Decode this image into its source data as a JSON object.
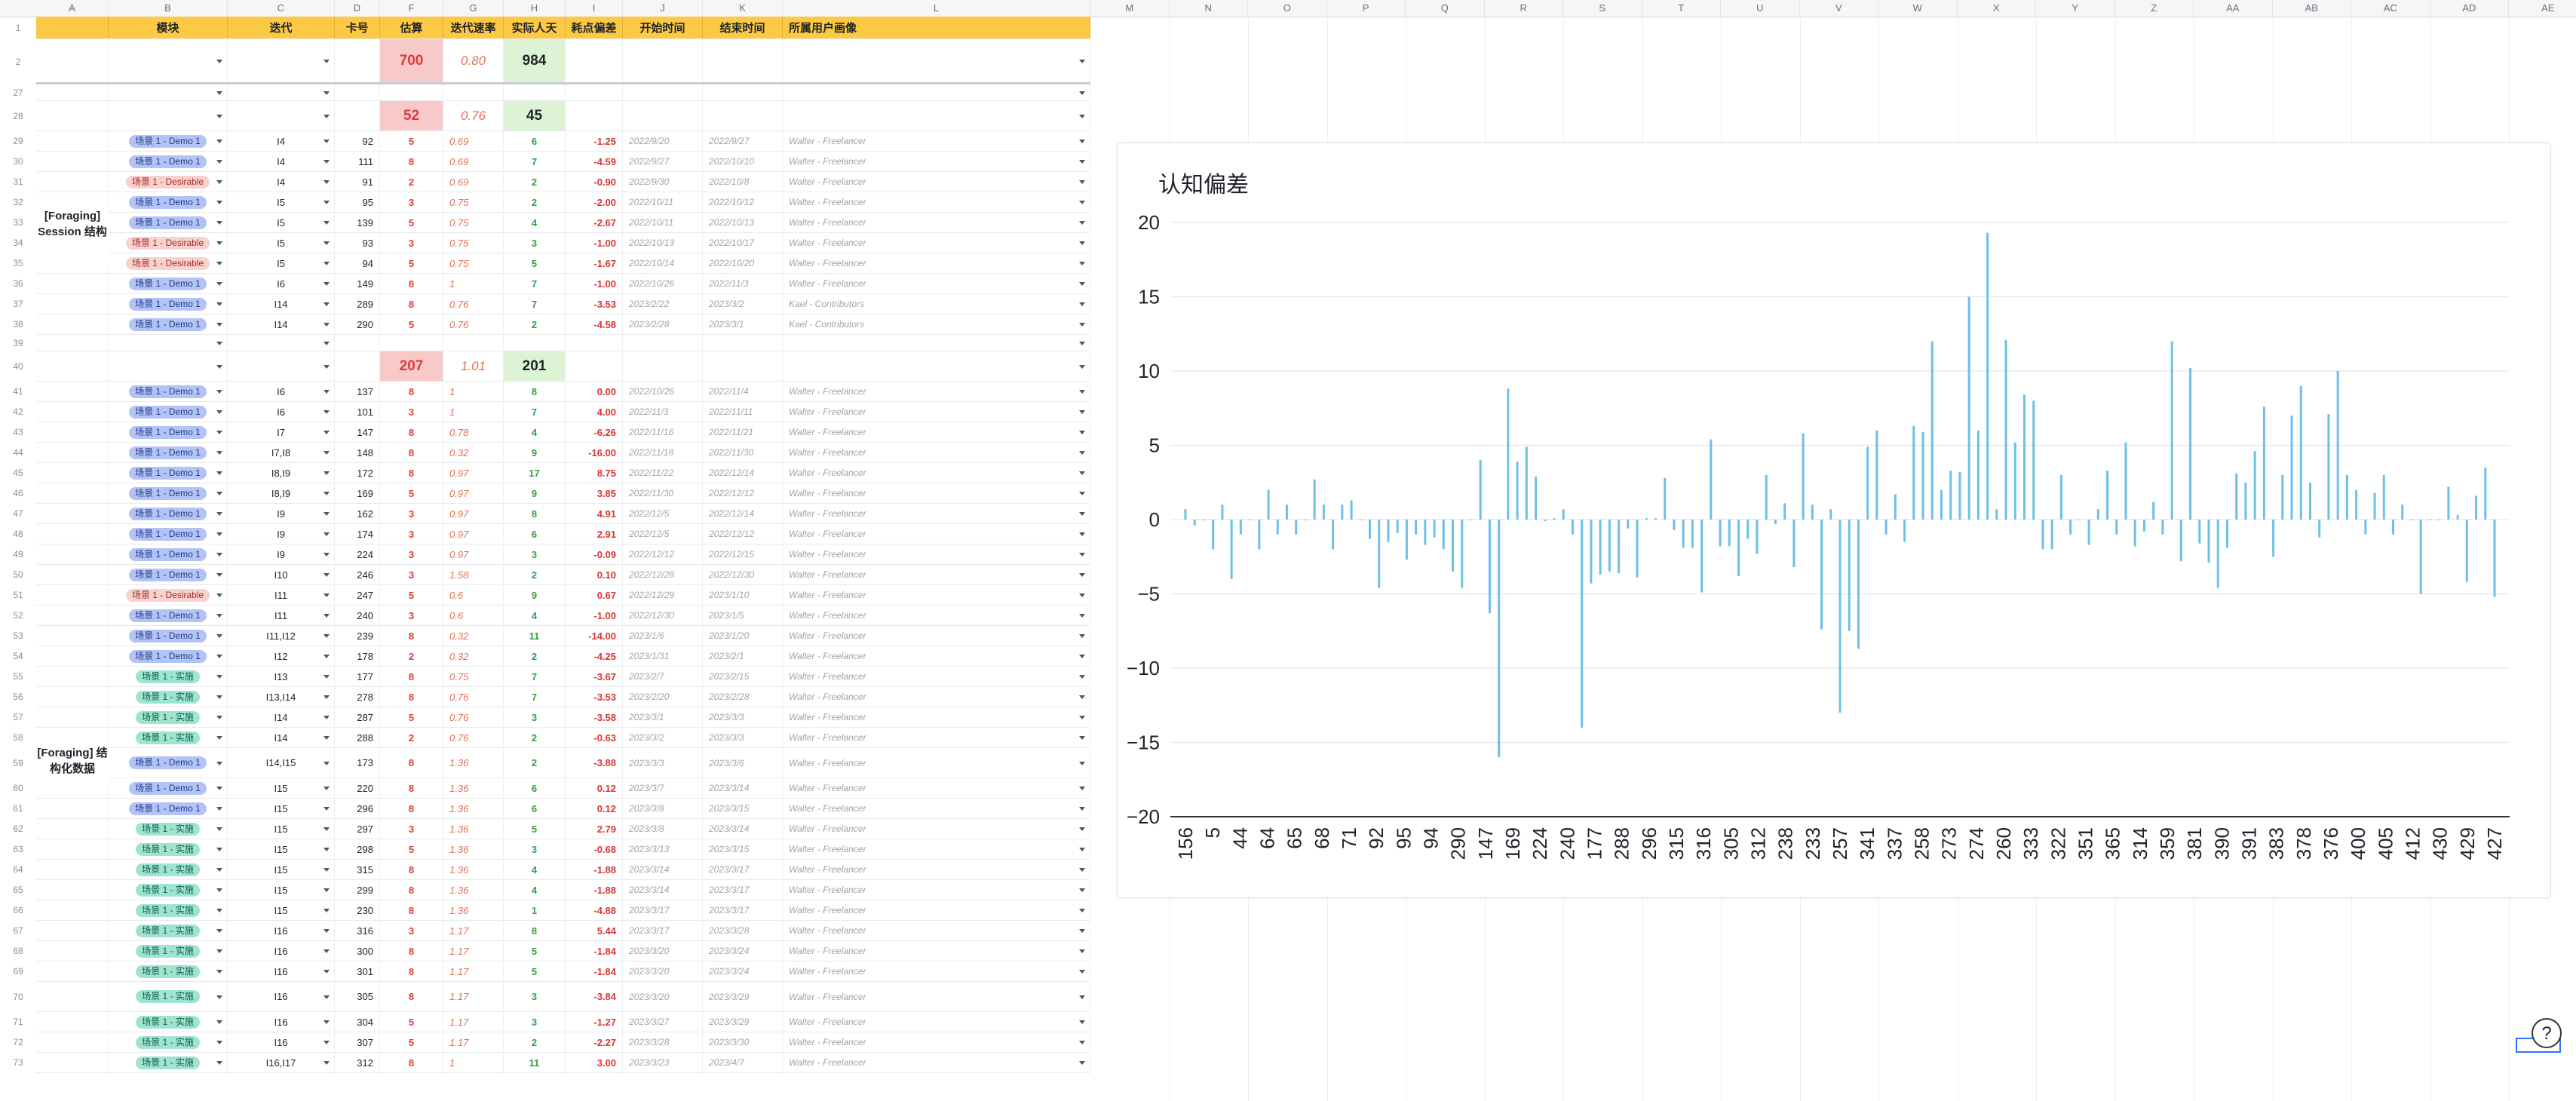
{
  "columns": [
    "A",
    "B",
    "C",
    "D",
    "F",
    "G",
    "H",
    "I",
    "J",
    "K",
    "L",
    "M",
    "N",
    "O",
    "P",
    "Q",
    "R",
    "S",
    "T",
    "U",
    "V",
    "W",
    "X",
    "Y",
    "Z",
    "AA",
    "AB",
    "AC",
    "AD",
    "AE"
  ],
  "header": {
    "module": "模块",
    "iteration": "迭代",
    "card": "卡号",
    "estimate": "估算",
    "velocity": "迭代速率",
    "actual_days": "实际人天",
    "deviation": "耗点偏差",
    "start": "开始时间",
    "end": "结束时间",
    "persona": "所属用户画像"
  },
  "summary_row2": {
    "estimate": "700",
    "velocity": "0.80",
    "actual": "984"
  },
  "summary_row28": {
    "estimate": "52",
    "velocity": "0.76",
    "actual": "45"
  },
  "summary_row40": {
    "estimate": "207",
    "velocity": "1.01",
    "actual": "201"
  },
  "section_labels": {
    "s1": "[Foraging] Session 结构",
    "s2": "[Foraging] 结构化数据"
  },
  "rows": [
    {
      "n": "29",
      "tag": "场景 1 - Demo 1",
      "t": "demo",
      "iter": "I4",
      "card": "92",
      "est": "5",
      "vel": "0.69",
      "act": "6",
      "dev": "-1.25",
      "s": "2022/9/20",
      "e": "2022/9/27",
      "p": "Walter - Freelancer"
    },
    {
      "n": "30",
      "tag": "场景 1 - Demo 1",
      "t": "demo",
      "iter": "I4",
      "card": "111",
      "est": "8",
      "vel": "0.69",
      "act": "7",
      "dev": "-4.59",
      "s": "2022/9/27",
      "e": "2022/10/10",
      "p": "Walter - Freelancer"
    },
    {
      "n": "31",
      "tag": "场景 1 - Desirable",
      "t": "des",
      "iter": "I4",
      "card": "91",
      "est": "2",
      "vel": "0.69",
      "act": "2",
      "dev": "-0.90",
      "s": "2022/9/30",
      "e": "2022/10/8",
      "p": "Walter - Freelancer"
    },
    {
      "n": "32",
      "tag": "场景 1 - Demo 1",
      "t": "demo",
      "iter": "I5",
      "card": "95",
      "est": "3",
      "vel": "0.75",
      "act": "2",
      "dev": "-2.00",
      "s": "2022/10/11",
      "e": "2022/10/12",
      "p": "Walter - Freelancer"
    },
    {
      "n": "33",
      "tag": "场景 1 - Demo 1",
      "t": "demo",
      "iter": "I5",
      "card": "139",
      "est": "5",
      "vel": "0.75",
      "act": "4",
      "dev": "-2.67",
      "s": "2022/10/11",
      "e": "2022/10/13",
      "p": "Walter - Freelancer"
    },
    {
      "n": "34",
      "tag": "场景 1 - Desirable",
      "t": "des",
      "iter": "I5",
      "card": "93",
      "est": "3",
      "vel": "0.75",
      "act": "3",
      "dev": "-1.00",
      "s": "2022/10/13",
      "e": "2022/10/17",
      "p": "Walter - Freelancer"
    },
    {
      "n": "35",
      "tag": "场景 1 - Desirable",
      "t": "des",
      "iter": "I5",
      "card": "94",
      "est": "5",
      "vel": "0.75",
      "act": "5",
      "dev": "-1.67",
      "s": "2022/10/14",
      "e": "2022/10/20",
      "p": "Walter - Freelancer"
    },
    {
      "n": "36",
      "tag": "场景 1 - Demo 1",
      "t": "demo",
      "iter": "I6",
      "card": "149",
      "est": "8",
      "vel": "1",
      "act": "7",
      "dev": "-1.00",
      "s": "2022/10/26",
      "e": "2022/11/3",
      "p": "Walter - Freelancer"
    },
    {
      "n": "37",
      "tag": "场景 1 - Demo 1",
      "t": "demo",
      "iter": "I14",
      "card": "289",
      "est": "8",
      "vel": "0.76",
      "act": "7",
      "dev": "-3.53",
      "s": "2023/2/22",
      "e": "2023/3/2",
      "p": "Kael - Contributors"
    },
    {
      "n": "38",
      "tag": "场景 1 - Demo 1",
      "t": "demo",
      "iter": "I14",
      "card": "290",
      "est": "5",
      "vel": "0.76",
      "act": "2",
      "dev": "-4.58",
      "s": "2023/2/28",
      "e": "2023/3/1",
      "p": "Kael - Contributors"
    }
  ],
  "rows2": [
    {
      "n": "41",
      "tag": "场景 1 - Demo 1",
      "t": "demo",
      "iter": "I6",
      "card": "137",
      "est": "8",
      "vel": "1",
      "act": "8",
      "dev": "0.00",
      "s": "2022/10/26",
      "e": "2022/11/4",
      "p": "Walter - Freelancer"
    },
    {
      "n": "42",
      "tag": "场景 1 - Demo 1",
      "t": "demo",
      "iter": "I6",
      "card": "101",
      "est": "3",
      "vel": "1",
      "act": "7",
      "dev": "4.00",
      "s": "2022/11/3",
      "e": "2022/11/11",
      "p": "Walter - Freelancer"
    },
    {
      "n": "43",
      "tag": "场景 1 - Demo 1",
      "t": "demo",
      "iter": "I7",
      "card": "147",
      "est": "8",
      "vel": "0.78",
      "act": "4",
      "dev": "-6.26",
      "s": "2022/11/16",
      "e": "2022/11/21",
      "p": "Walter - Freelancer"
    },
    {
      "n": "44",
      "tag": "场景 1 - Demo 1",
      "t": "demo",
      "iter": "I7,I8",
      "card": "148",
      "est": "8",
      "vel": "0.32",
      "act": "9",
      "dev": "-16.00",
      "s": "2022/11/18",
      "e": "2022/11/30",
      "p": "Walter - Freelancer"
    },
    {
      "n": "45",
      "tag": "场景 1 - Demo 1",
      "t": "demo",
      "iter": "I8,I9",
      "card": "172",
      "est": "8",
      "vel": "0.97",
      "act": "17",
      "dev": "8.75",
      "s": "2022/11/22",
      "e": "2022/12/14",
      "p": "Walter - Freelancer"
    },
    {
      "n": "46",
      "tag": "场景 1 - Demo 1",
      "t": "demo",
      "iter": "I8,I9",
      "card": "169",
      "est": "5",
      "vel": "0.97",
      "act": "9",
      "dev": "3.85",
      "s": "2022/11/30",
      "e": "2022/12/12",
      "p": "Walter - Freelancer"
    },
    {
      "n": "47",
      "tag": "场景 1 - Demo 1",
      "t": "demo",
      "iter": "I9",
      "card": "162",
      "est": "3",
      "vel": "0.97",
      "act": "8",
      "dev": "4.91",
      "s": "2022/12/5",
      "e": "2022/12/14",
      "p": "Walter - Freelancer"
    },
    {
      "n": "48",
      "tag": "场景 1 - Demo 1",
      "t": "demo",
      "iter": "I9",
      "card": "174",
      "est": "3",
      "vel": "0.97",
      "act": "6",
      "dev": "2.91",
      "s": "2022/12/5",
      "e": "2022/12/12",
      "p": "Walter - Freelancer"
    },
    {
      "n": "49",
      "tag": "场景 1 - Demo 1",
      "t": "demo",
      "iter": "I9",
      "card": "224",
      "est": "3",
      "vel": "0.97",
      "act": "3",
      "dev": "-0.09",
      "s": "2022/12/12",
      "e": "2022/12/15",
      "p": "Walter - Freelancer"
    },
    {
      "n": "50",
      "tag": "场景 1 - Demo 1",
      "t": "demo",
      "iter": "I10",
      "card": "246",
      "est": "3",
      "vel": "1.58",
      "act": "2",
      "dev": "0.10",
      "s": "2022/12/28",
      "e": "2022/12/30",
      "p": "Walter - Freelancer"
    },
    {
      "n": "51",
      "tag": "场景 1 - Desirable",
      "t": "des",
      "iter": "I11",
      "card": "247",
      "est": "5",
      "vel": "0.6",
      "act": "9",
      "dev": "0.67",
      "s": "2022/12/29",
      "e": "2023/1/10",
      "p": "Walter - Freelancer"
    },
    {
      "n": "52",
      "tag": "场景 1 - Demo 1",
      "t": "demo",
      "iter": "I11",
      "card": "240",
      "est": "3",
      "vel": "0.6",
      "act": "4",
      "dev": "-1.00",
      "s": "2022/12/30",
      "e": "2023/1/5",
      "p": "Walter - Freelancer"
    },
    {
      "n": "53",
      "tag": "场景 1 - Demo 1",
      "t": "demo",
      "iter": "I11,I12",
      "card": "239",
      "est": "8",
      "vel": "0.32",
      "act": "11",
      "dev": "-14.00",
      "s": "2023/1/6",
      "e": "2023/1/20",
      "p": "Walter - Freelancer"
    },
    {
      "n": "54",
      "tag": "场景 1 - Demo 1",
      "t": "demo",
      "iter": "I12",
      "card": "178",
      "est": "2",
      "vel": "0.32",
      "act": "2",
      "dev": "-4.25",
      "s": "2023/1/31",
      "e": "2023/2/1",
      "p": "Walter - Freelancer"
    },
    {
      "n": "55",
      "tag": "场景 1 - 实施",
      "t": "shi",
      "iter": "I13",
      "card": "177",
      "est": "8",
      "vel": "0.75",
      "act": "7",
      "dev": "-3.67",
      "s": "2023/2/7",
      "e": "2023/2/15",
      "p": "Walter - Freelancer"
    },
    {
      "n": "56",
      "tag": "场景 1 - 实施",
      "t": "shi",
      "iter": "I13,I14",
      "card": "278",
      "est": "8",
      "vel": "0.76",
      "act": "7",
      "dev": "-3.53",
      "s": "2023/2/20",
      "e": "2023/2/28",
      "p": "Walter - Freelancer"
    },
    {
      "n": "57",
      "tag": "场景 1 - 实施",
      "t": "shi",
      "iter": "I14",
      "card": "287",
      "est": "5",
      "vel": "0.76",
      "act": "3",
      "dev": "-3.58",
      "s": "2023/3/1",
      "e": "2023/3/3",
      "p": "Walter - Freelancer"
    },
    {
      "n": "58",
      "tag": "场景 1 - 实施",
      "t": "shi",
      "iter": "I14",
      "card": "288",
      "est": "2",
      "vel": "0.76",
      "act": "2",
      "dev": "-0.63",
      "s": "2023/3/2",
      "e": "2023/3/3",
      "p": "Walter - Freelancer"
    },
    {
      "n": "59",
      "tag": "场景 1 - Demo 1",
      "t": "demo",
      "iter": "I14,I15",
      "card": "173",
      "est": "8",
      "vel": "1.36",
      "act": "2",
      "dev": "-3.88",
      "s": "2023/3/3",
      "e": "2023/3/6",
      "p": "Walter - Freelancer"
    },
    {
      "n": "60",
      "tag": "场景 1 - Demo 1",
      "t": "demo",
      "iter": "I15",
      "card": "220",
      "est": "8",
      "vel": "1.36",
      "act": "6",
      "dev": "0.12",
      "s": "2023/3/7",
      "e": "2023/3/14",
      "p": "Walter - Freelancer"
    },
    {
      "n": "61",
      "tag": "场景 1 - Demo 1",
      "t": "demo",
      "iter": "I15",
      "card": "296",
      "est": "8",
      "vel": "1.36",
      "act": "6",
      "dev": "0.12",
      "s": "2023/3/8",
      "e": "2023/3/15",
      "p": "Walter - Freelancer"
    },
    {
      "n": "62",
      "tag": "场景 1 - 实施",
      "t": "shi",
      "iter": "I15",
      "card": "297",
      "est": "3",
      "vel": "1.36",
      "act": "5",
      "dev": "2.79",
      "s": "2023/3/8",
      "e": "2023/3/14",
      "p": "Walter - Freelancer"
    },
    {
      "n": "63",
      "tag": "场景 1 - 实施",
      "t": "shi",
      "iter": "I15",
      "card": "298",
      "est": "5",
      "vel": "1.36",
      "act": "3",
      "dev": "-0.68",
      "s": "2023/3/13",
      "e": "2023/3/15",
      "p": "Walter - Freelancer"
    },
    {
      "n": "64",
      "tag": "场景 1 - 实施",
      "t": "shi",
      "iter": "I15",
      "card": "315",
      "est": "8",
      "vel": "1.36",
      "act": "4",
      "dev": "-1.88",
      "s": "2023/3/14",
      "e": "2023/3/17",
      "p": "Walter - Freelancer"
    },
    {
      "n": "65",
      "tag": "场景 1 - 实施",
      "t": "shi",
      "iter": "I15",
      "card": "299",
      "est": "8",
      "vel": "1.36",
      "act": "4",
      "dev": "-1.88",
      "s": "2023/3/14",
      "e": "2023/3/17",
      "p": "Walter - Freelancer"
    },
    {
      "n": "66",
      "tag": "场景 1 - 实施",
      "t": "shi",
      "iter": "I15",
      "card": "230",
      "est": "8",
      "vel": "1.36",
      "act": "1",
      "dev": "-4.88",
      "s": "2023/3/17",
      "e": "2023/3/17",
      "p": "Walter - Freelancer"
    },
    {
      "n": "67",
      "tag": "场景 1 - 实施",
      "t": "shi",
      "iter": "I16",
      "card": "316",
      "est": "3",
      "vel": "1.17",
      "act": "8",
      "dev": "5.44",
      "s": "2023/3/17",
      "e": "2023/3/28",
      "p": "Walter - Freelancer"
    },
    {
      "n": "68",
      "tag": "场景 1 - 实施",
      "t": "shi",
      "iter": "I16",
      "card": "300",
      "est": "8",
      "vel": "1.17",
      "act": "5",
      "dev": "-1.84",
      "s": "2023/3/20",
      "e": "2023/3/24",
      "p": "Walter - Freelancer"
    },
    {
      "n": "69",
      "tag": "场景 1 - 实施",
      "t": "shi",
      "iter": "I16",
      "card": "301",
      "est": "8",
      "vel": "1.17",
      "act": "5",
      "dev": "-1.84",
      "s": "2023/3/20",
      "e": "2023/3/24",
      "p": "Walter - Freelancer"
    },
    {
      "n": "70",
      "tag": "场景 1 - 实施",
      "t": "shi",
      "iter": "I16",
      "card": "305",
      "est": "8",
      "vel": "1.17",
      "act": "3",
      "dev": "-3.84",
      "s": "2023/3/20",
      "e": "2023/3/29",
      "p": "Walter - Freelancer"
    },
    {
      "n": "71",
      "tag": "场景 1 - 实施",
      "t": "shi",
      "iter": "I16",
      "card": "304",
      "est": "5",
      "vel": "1.17",
      "act": "3",
      "dev": "-1.27",
      "s": "2023/3/27",
      "e": "2023/3/29",
      "p": "Walter - Freelancer"
    },
    {
      "n": "72",
      "tag": "场景 1 - 实施",
      "t": "shi",
      "iter": "I16",
      "card": "307",
      "est": "5",
      "vel": "1.17",
      "act": "2",
      "dev": "-2.27",
      "s": "2023/3/28",
      "e": "2023/3/30",
      "p": "Walter - Freelancer"
    },
    {
      "n": "73",
      "tag": "场景 1 - 实施",
      "t": "shi",
      "iter": "I16,I17",
      "card": "312",
      "est": "8",
      "vel": "1",
      "act": "11",
      "dev": "3.00",
      "s": "2023/3/23",
      "e": "2023/4/7",
      "p": "Walter - Freelancer"
    }
  ],
  "chart_data": {
    "type": "bar",
    "title": "认知偏差",
    "ylim": [
      -20,
      20
    ],
    "yticks": [
      "20",
      "15",
      "10",
      "5",
      "0",
      "−5",
      "−10",
      "−15",
      "−20"
    ],
    "xtick_labels": [
      "156",
      "5",
      "44",
      "64",
      "65",
      "68",
      "71",
      "92",
      "95",
      "94",
      "290",
      "147",
      "169",
      "224",
      "240",
      "177",
      "288",
      "296",
      "315",
      "316",
      "305",
      "312",
      "238",
      "233",
      "257",
      "341",
      "337",
      "258",
      "273",
      "274",
      "260",
      "333",
      "322",
      "351",
      "365",
      "314",
      "359",
      "381",
      "390",
      "391",
      "383",
      "378",
      "376",
      "400",
      "405",
      "412",
      "430",
      "429",
      "427"
    ],
    "color": "#6cc1e4",
    "values": [
      0.7,
      -0.4,
      0,
      -2,
      1,
      -4,
      -1,
      0,
      -2,
      2,
      -1,
      1,
      -1,
      0,
      2.7,
      1,
      -2,
      1,
      1.3,
      0,
      -1.3,
      -4.6,
      -1.5,
      -0.9,
      -2.7,
      -1,
      -1.7,
      -1.2,
      -2,
      -3.5,
      -4.6,
      0,
      4,
      -6.3,
      -16,
      8.8,
      3.9,
      4.9,
      2.9,
      -0.1,
      0.1,
      0.7,
      -1,
      -14,
      -4.3,
      -3.7,
      -3.5,
      -3.6,
      -0.6,
      -3.9,
      0.1,
      0.1,
      2.8,
      -0.7,
      -1.9,
      -1.9,
      -4.9,
      5.4,
      -1.8,
      -1.8,
      -3.8,
      -1.3,
      -2.3,
      3,
      -0.3,
      1.1,
      -3.2,
      5.8,
      1,
      -7.4,
      0.7,
      -13,
      -7.5,
      -8.7,
      4.9,
      6,
      -1,
      1.7,
      -1.5,
      6.3,
      5.9,
      12,
      2,
      3.3,
      3.2,
      15,
      6,
      19.3,
      0.7,
      12.1,
      5.2,
      8.4,
      8,
      -2,
      -2,
      3,
      -1,
      0,
      -1.7,
      0.7,
      3.3,
      -1,
      5.2,
      -1.8,
      -0.8,
      1.2,
      -1,
      12,
      -2.8,
      10.2,
      -1.6,
      -2.9,
      -4.6,
      -1.9,
      3.1,
      2.5,
      4.6,
      7.6,
      -2.5,
      3,
      7,
      9,
      2.5,
      -1.2,
      7.1,
      10,
      3,
      2,
      -1,
      1.8,
      3,
      -1,
      1,
      0,
      -5,
      0,
      0,
      2.2,
      0.3,
      -4.2,
      1.6,
      3.5,
      -5.2
    ]
  },
  "help_label": "?"
}
